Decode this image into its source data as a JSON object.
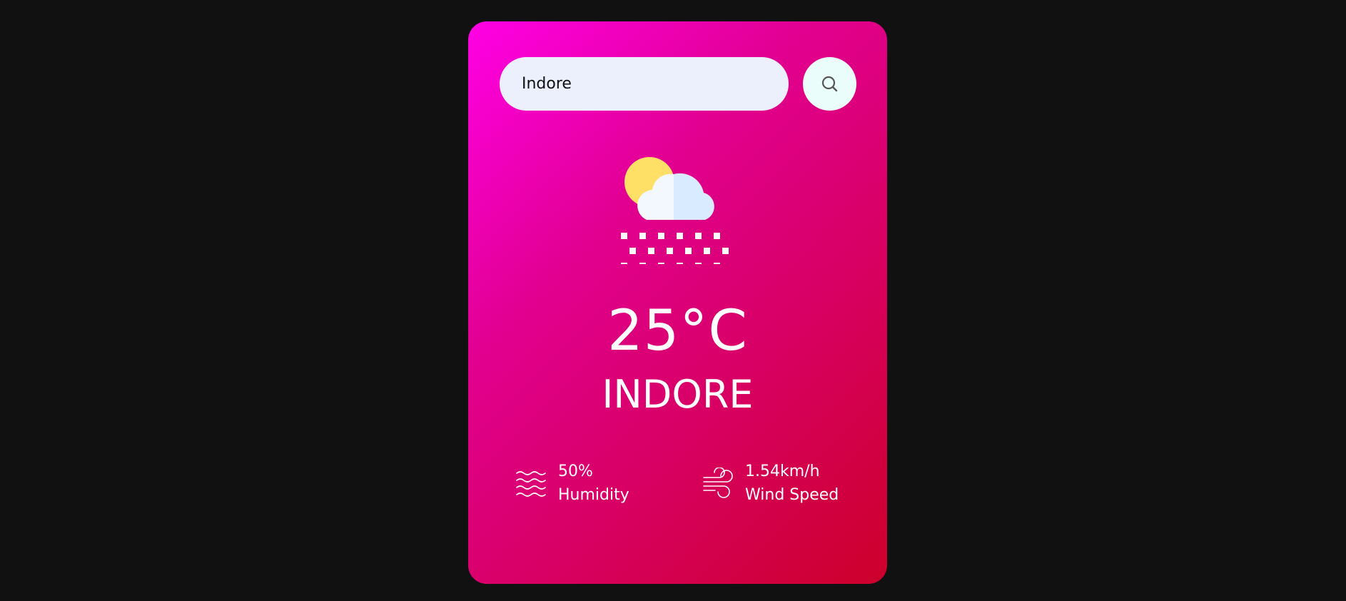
{
  "search": {
    "value": "Indore",
    "placeholder": ""
  },
  "weather": {
    "icon": "sun-cloud-snow-icon",
    "temperature": "25°C",
    "city": "INDORE"
  },
  "details": {
    "humidity": {
      "value": "50%",
      "label": "Humidity",
      "icon": "humidity-waves-icon"
    },
    "wind": {
      "value": "1.54km/h",
      "label": "Wind Speed",
      "icon": "wind-icon"
    }
  },
  "colors": {
    "background": "#111111",
    "card_gradient_start": "#ff00e6",
    "card_gradient_end": "#cc002a",
    "input_bg": "#ebf0fc",
    "button_bg": "#eafdfa",
    "text": "#ffffff"
  }
}
